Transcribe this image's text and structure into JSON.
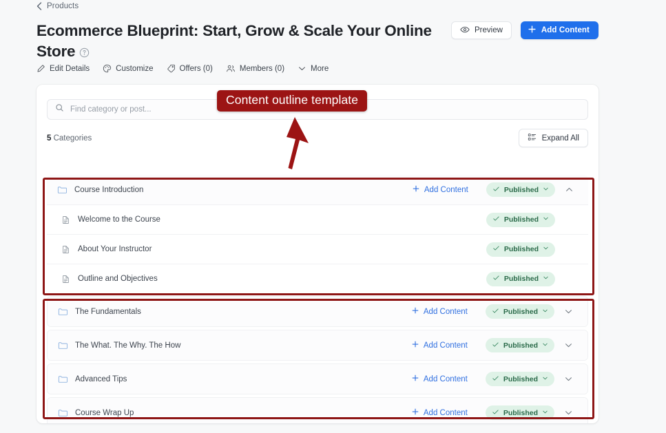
{
  "breadcrumb": {
    "label": "Products",
    "icon": "chevron-left-icon"
  },
  "header": {
    "title": "Ecommerce Blueprint: Start, Grow & Scale Your Online Store",
    "help_icon": "question-circle-icon",
    "preview_button": "Preview",
    "preview_icon": "eye-icon",
    "add_content_button": "Add Content",
    "add_content_icon": "plus-icon"
  },
  "tabs": [
    {
      "label": "Edit Details",
      "icon": "pencil-icon"
    },
    {
      "label": "Customize",
      "icon": "palette-icon"
    },
    {
      "label": "Offers (0)",
      "icon": "tag-icon"
    },
    {
      "label": "Members (0)",
      "icon": "people-icon"
    },
    {
      "label": "More",
      "icon": "chevron-down-icon"
    }
  ],
  "search": {
    "placeholder": "Find category or post...",
    "value": "",
    "icon": "search-icon"
  },
  "toolbar": {
    "count_number": "5",
    "count_label": "Categories",
    "expand_all_label": "Expand All",
    "expand_all_icon": "list-grid-icon"
  },
  "labels": {
    "add_content": "Add Content",
    "published": "Published",
    "folder_icon": "folder-icon",
    "document_icon": "document-icon",
    "plus_icon": "plus-icon",
    "check_icon": "check-icon",
    "badge_chevron_icon": "chevron-down-icon",
    "collapse_icon": "chevron-up-icon",
    "expand_icon": "chevron-down-icon"
  },
  "outline": {
    "groups": [
      {
        "category": {
          "title": "Course Introduction",
          "add_content": "Add Content",
          "status": "Published",
          "expanded": true
        },
        "children": [
          {
            "title": "Welcome to the Course",
            "status": "Published"
          },
          {
            "title": "About Your Instructor",
            "status": "Published"
          },
          {
            "title": "Outline and Objectives",
            "status": "Published"
          }
        ]
      },
      {
        "category": {
          "title": "The Fundamentals",
          "add_content": "Add Content",
          "status": "Published",
          "expanded": false
        },
        "children": []
      },
      {
        "category": {
          "title": "The What. The Why. The How",
          "add_content": "Add Content",
          "status": "Published",
          "expanded": false
        },
        "children": []
      },
      {
        "category": {
          "title": "Advanced Tips",
          "add_content": "Add Content",
          "status": "Published",
          "expanded": false
        },
        "children": []
      },
      {
        "category": {
          "title": "Course Wrap Up",
          "add_content": "Add Content",
          "status": "Published",
          "expanded": false
        },
        "children": []
      }
    ]
  },
  "annotation": {
    "label": "Content outline template",
    "color": "#9c1414",
    "box_color": "#8e1616",
    "arrow_icon": "arrow-up-icon"
  },
  "colors": {
    "accent_blue": "#1f6feb",
    "link_blue": "#2f6fe0",
    "badge_bg": "#dff2e7",
    "badge_text": "#2b6b4a",
    "page_bg": "#f7f8f9",
    "card_bg": "#ffffff",
    "folder_blue": "#8fb3e0"
  }
}
